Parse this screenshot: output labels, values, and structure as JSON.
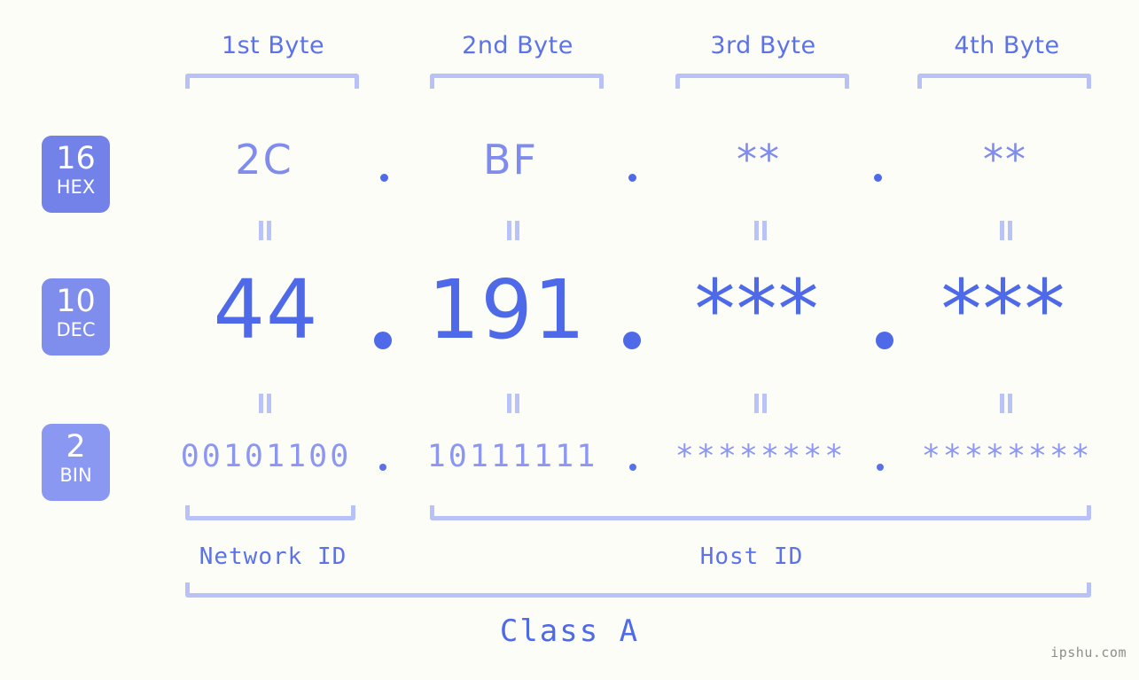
{
  "watermark": "ipshu.com",
  "columns": [
    {
      "header": "1st Byte",
      "hex": "2C",
      "dec": "44",
      "bin": "00101100"
    },
    {
      "header": "2nd Byte",
      "hex": "BF",
      "dec": "191",
      "bin": "10111111"
    },
    {
      "header": "3rd Byte",
      "hex": "**",
      "dec": "***",
      "bin": "********"
    },
    {
      "header": "4th Byte",
      "hex": "**",
      "dec": "***",
      "bin": "********"
    }
  ],
  "bases": [
    {
      "number": "16",
      "label": "HEX",
      "color": "#7382e8"
    },
    {
      "number": "10",
      "label": "DEC",
      "color": "#7f8ded"
    },
    {
      "number": "2",
      "label": "BIN",
      "color": "#8b98f2"
    }
  ],
  "separator": ".",
  "ids": {
    "network": "Network ID",
    "host": "Host ID"
  },
  "class": "Class A",
  "colors": {
    "background": "#fdfdf8",
    "accent_strong": "#4f6ae8",
    "accent_mid": "#5c72e8",
    "accent_light": "#8b97f2",
    "bracket": "#b9c2f7"
  }
}
